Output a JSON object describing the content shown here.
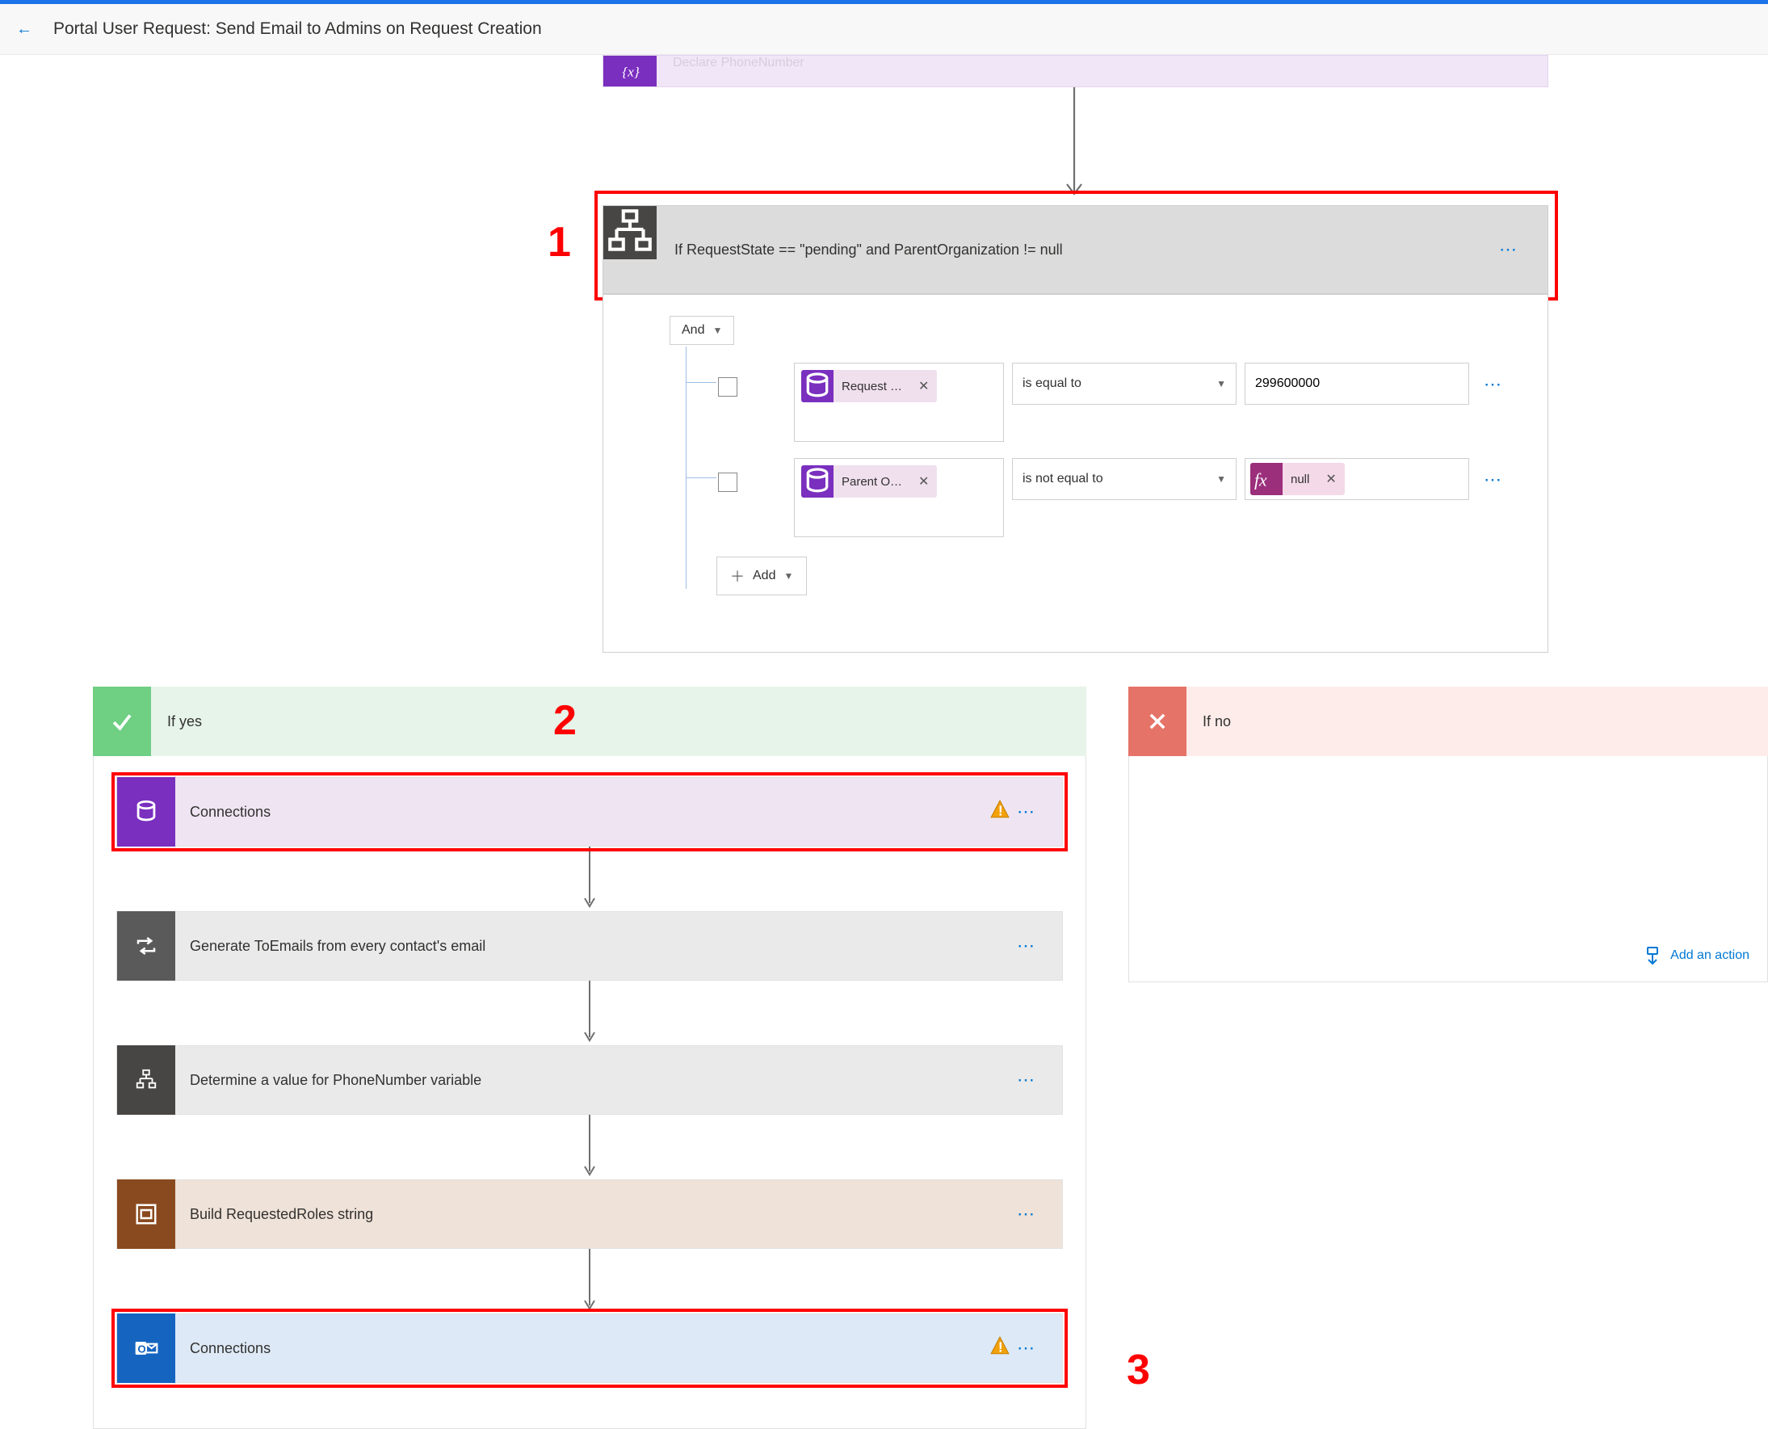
{
  "header": {
    "title": "Portal User Request: Send Email to Admins on Request Creation"
  },
  "top_declare": {
    "label": "Declare PhoneNumber"
  },
  "condition": {
    "title": "If RequestState == \"pending\" and ParentOrganization != null",
    "group_op": "And",
    "rows": [
      {
        "token": "Request …",
        "operator": "is equal to",
        "value": "299600000"
      },
      {
        "token": "Parent O…",
        "operator": "is not equal to",
        "value_fx": "null"
      }
    ],
    "add_label": "Add"
  },
  "branches": {
    "yes": {
      "label": "If yes",
      "steps": [
        {
          "id": "connections-dv",
          "label": "Connections",
          "style": "purple",
          "warn": true,
          "highlight": true
        },
        {
          "id": "gen-toemails",
          "label": "Generate ToEmails from every contact's email",
          "style": "gray"
        },
        {
          "id": "determine-phone",
          "label": "Determine a value for PhoneNumber variable",
          "style": "cond"
        },
        {
          "id": "build-roles",
          "label": "Build RequestedRoles string",
          "style": "brown"
        },
        {
          "id": "connections-outlook",
          "label": "Connections",
          "style": "blue",
          "warn": true,
          "highlight": true
        }
      ]
    },
    "no": {
      "label": "If no",
      "add_action_label": "Add an action"
    }
  },
  "annotations": {
    "a1": "1",
    "a2": "2",
    "a3": "3"
  }
}
